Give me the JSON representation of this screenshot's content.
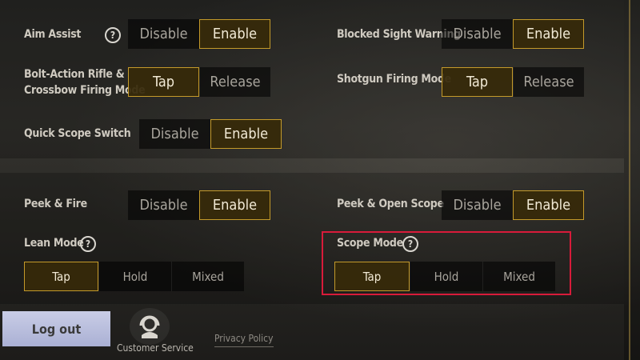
{
  "settings": {
    "aim_assist": {
      "label": "Aim Assist",
      "options": [
        "Disable",
        "Enable"
      ],
      "selected": "Enable"
    },
    "blocked_sight": {
      "label": "Blocked Sight Warning",
      "options": [
        "Disable",
        "Enable"
      ],
      "selected": "Enable"
    },
    "bolt_action": {
      "label_line1": "Bolt-Action Rifle &",
      "label_line2": "Crossbow Firing Mode",
      "options": [
        "Tap",
        "Release"
      ],
      "selected": "Tap"
    },
    "shotgun": {
      "label": "Shotgun Firing Mode",
      "options": [
        "Tap",
        "Release"
      ],
      "selected": "Tap"
    },
    "quick_scope": {
      "label": "Quick Scope Switch",
      "options": [
        "Disable",
        "Enable"
      ],
      "selected": "Enable"
    },
    "peek_fire": {
      "label": "Peek & Fire",
      "options": [
        "Disable",
        "Enable"
      ],
      "selected": "Enable"
    },
    "peek_scope": {
      "label": "Peek & Open Scope",
      "options": [
        "Disable",
        "Enable"
      ],
      "selected": "Enable"
    },
    "lean_mode": {
      "label": "Lean Mode",
      "options": [
        "Tap",
        "Hold",
        "Mixed"
      ],
      "selected": "Tap"
    },
    "scope_mode": {
      "label": "Scope Mode",
      "options": [
        "Tap",
        "Hold",
        "Mixed"
      ],
      "selected": "Tap"
    }
  },
  "help_glyph": "?",
  "footer": {
    "logout": "Log out",
    "customer_service": "Customer Service",
    "privacy_policy": "Privacy Policy"
  },
  "colors": {
    "accent": "#c49a2a",
    "highlight": "#d81b3a",
    "logout_bg": "#bcc1de"
  },
  "icons": {
    "help": "question-circle-icon",
    "customer_service": "headset-icon"
  }
}
